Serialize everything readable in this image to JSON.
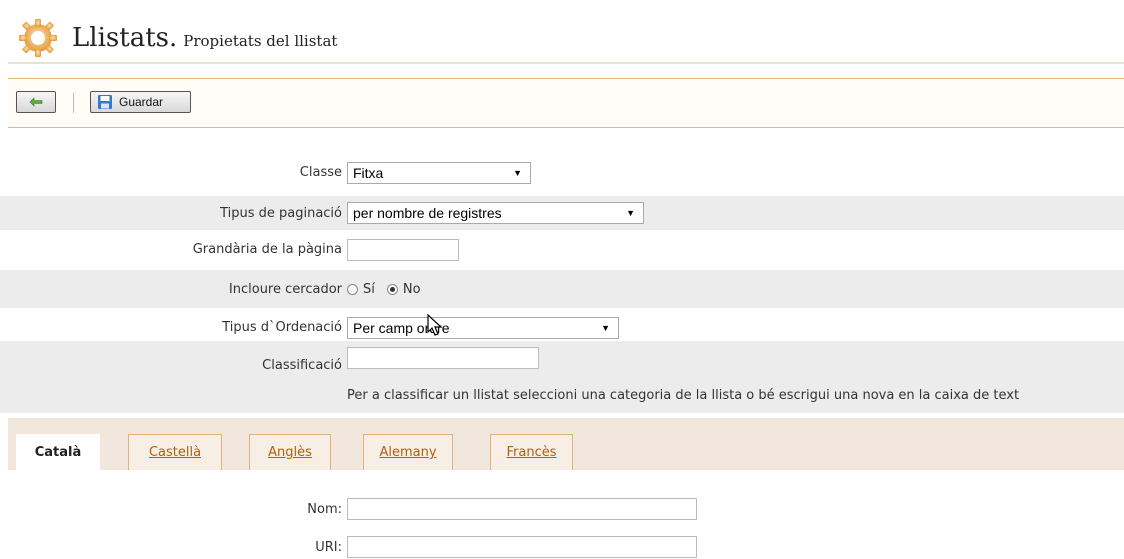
{
  "header": {
    "title": "Llistats.",
    "subtitle": "Propietats del llistat"
  },
  "toolbar": {
    "save_label": "Guardar"
  },
  "form": {
    "classe": {
      "label": "Classe",
      "value": "Fitxa"
    },
    "paginacio": {
      "label": "Tipus de paginació",
      "value": "per nombre de registres"
    },
    "grandaria": {
      "label": "Grandària de la pàgina",
      "value": ""
    },
    "cercador": {
      "label": "Incloure cercador",
      "option_si": "Sí",
      "option_no": "No",
      "selected": "No"
    },
    "ordenacio": {
      "label": "Tipus d`Ordenació",
      "value": "Per camp ordre"
    },
    "classificacio": {
      "label": "Classificació",
      "value": "",
      "help": "Per a classificar un llistat seleccioni una categoria de la llista o bé escrigui una nova en la caixa de text"
    }
  },
  "tabs": [
    {
      "label": "Català",
      "active": true
    },
    {
      "label": "Castellà",
      "active": false
    },
    {
      "label": "Anglès",
      "active": false
    },
    {
      "label": "Alemany",
      "active": false
    },
    {
      "label": "Francès",
      "active": false
    }
  ],
  "lang_form": {
    "nom": {
      "label": "Nom:",
      "value": ""
    },
    "uri": {
      "label": "URI:",
      "value": ""
    }
  },
  "colors": {
    "accent_border": "#e8b87a",
    "tab_link": "#b25f0a",
    "row_shade": "#ececec",
    "tabs_bg": "#f2e7dc"
  }
}
